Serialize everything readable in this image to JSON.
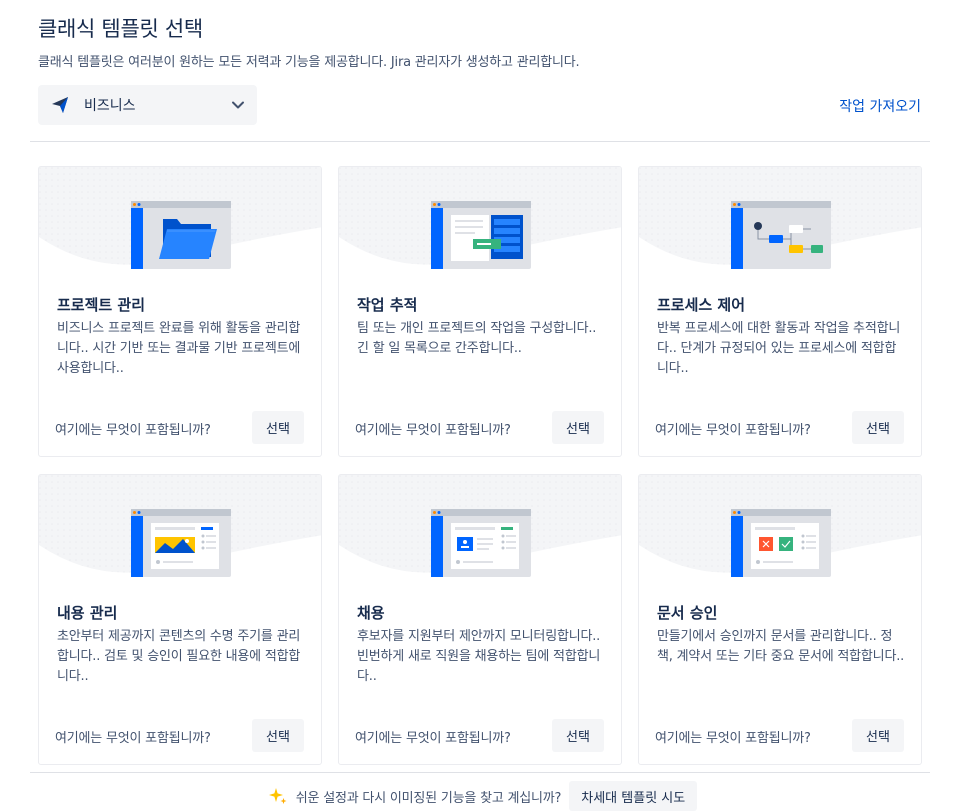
{
  "header": {
    "title": "클래식 템플릿 선택",
    "subtitle": "클래식 템플릿은 여러분이 원하는 모든 저력과 기능을 제공합니다. Jira 관리자가 생성하고 관리합니다."
  },
  "category": {
    "selected": "비즈니스",
    "icon": "business-logo-icon"
  },
  "import_link": "작업 가져오기",
  "cards": [
    {
      "title": "프로젝트 관리",
      "description": "비즈니스 프로젝트 완료를 위해 활동을 관리합니다.. 시간 기반 또는 결과물 기반 프로젝트에 사용합니다..",
      "more": "여기에는 무엇이 포함됩니까?",
      "select": "선택",
      "icon": "folder-illustration"
    },
    {
      "title": "작업 추적",
      "description": "팀 또는 개인 프로젝트의 작업을 구성합니다.. 긴 할 일 목록으로 간주합니다..",
      "more": "여기에는 무엇이 포함됩니까?",
      "select": "선택",
      "icon": "task-tracker-illustration"
    },
    {
      "title": "프로세스 제어",
      "description": "반복 프로세스에 대한 활동과 작업을 추적합니다.. 단계가 규정되어 있는 프로세스에 적합합니다..",
      "more": "여기에는 무엇이 포함됩니까?",
      "select": "선택",
      "icon": "workflow-illustration"
    },
    {
      "title": "내용 관리",
      "description": "초안부터 제공까지 콘텐츠의 수명 주기를 관리합니다.. 검토 및 승인이 필요한 내용에 적합합니다..",
      "more": "여기에는 무엇이 포함됩니까?",
      "select": "선택",
      "icon": "image-content-illustration"
    },
    {
      "title": "채용",
      "description": "후보자를 지원부터 제안까지 모니터링합니다.. 빈번하게 새로 직원을 채용하는 팀에 적합합니다..",
      "more": "여기에는 무엇이 포함됩니까?",
      "select": "선택",
      "icon": "recruitment-illustration"
    },
    {
      "title": "문서 승인",
      "description": "만들기에서 승인까지 문서를 관리합니다.. 정책, 계약서 또는 기타 중요 문서에 적합합니다..",
      "more": "여기에는 무엇이 포함됩니까?",
      "select": "선택",
      "icon": "document-approval-illustration"
    }
  ],
  "footer": {
    "message": "쉬운 설정과 다시 이미징된 기능을 찾고 계십니까?",
    "button": "차세대 템플릿 시도",
    "icon": "sparkle-icon"
  },
  "colors": {
    "link": "#0052cc",
    "text": "#172b4d",
    "subtle": "#42526e",
    "button_bg": "#f4f5f7",
    "accent_blue": "#0065ff"
  }
}
